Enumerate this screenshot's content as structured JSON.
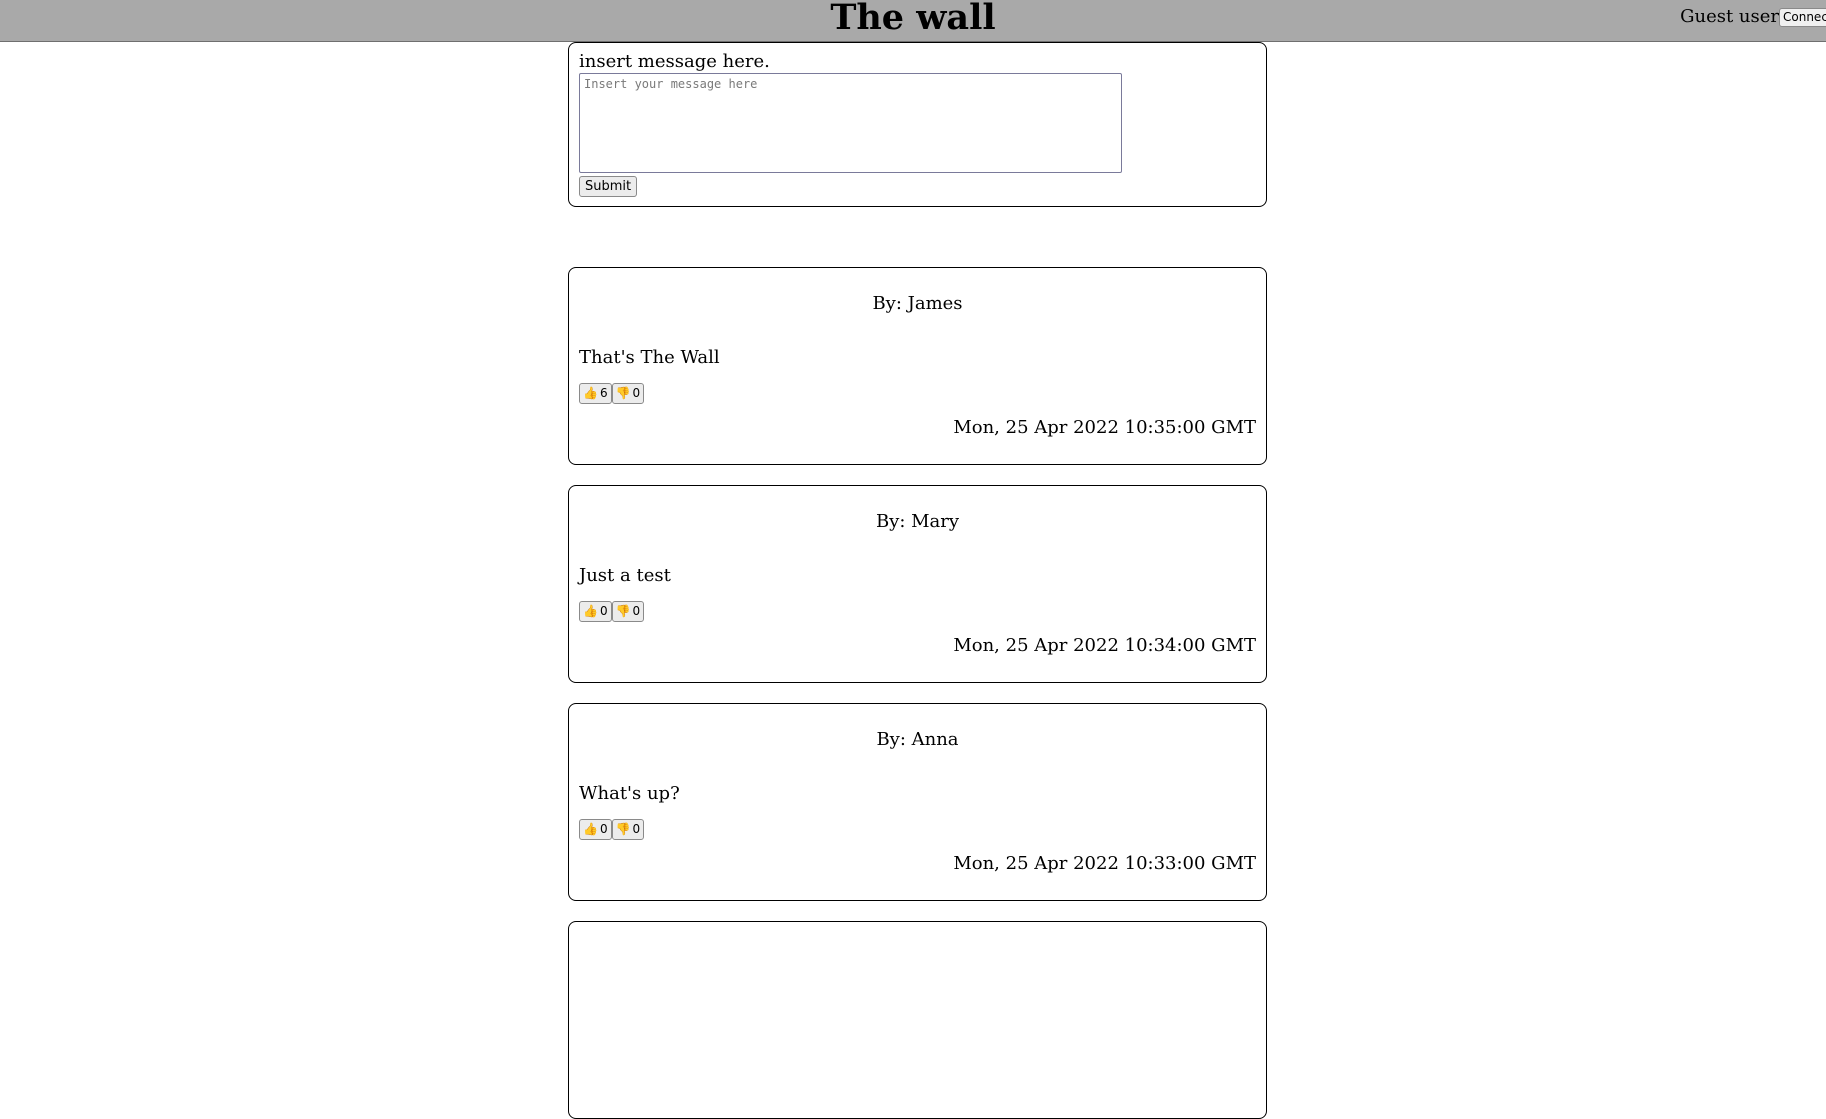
{
  "header": {
    "title": "The wall",
    "user_label": "Guest user",
    "connect_label": "Connect"
  },
  "composer": {
    "label": "insert message here.",
    "placeholder": "Insert your message here",
    "submit_label": "Submit"
  },
  "posts": [
    {
      "author": "By: James",
      "body": "That's The Wall",
      "likes": "6",
      "dislikes": "0",
      "date": "Mon, 25 Apr 2022 10:35:00 GMT"
    },
    {
      "author": "By: Mary",
      "body": "Just a test",
      "likes": "0",
      "dislikes": "0",
      "date": "Mon, 25 Apr 2022 10:34:00 GMT"
    },
    {
      "author": "By: Anna",
      "body": "What's up?",
      "likes": "0",
      "dislikes": "0",
      "date": "Mon, 25 Apr 2022 10:33:00 GMT"
    }
  ],
  "icons": {
    "like": "thumbs-up-icon",
    "dislike": "thumbs-down-icon"
  }
}
